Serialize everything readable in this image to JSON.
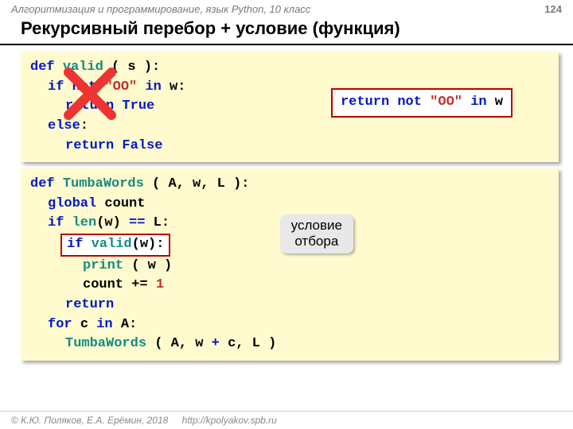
{
  "header": {
    "course": "Алгоритмизация и программирование, язык Python, 10 класс",
    "page": "124"
  },
  "title": "Рекурсивный перебор + условие (функция)",
  "code1": {
    "l1a": "def",
    "l1b": "valid",
    "l1c": "( s ):",
    "l2a": "if not",
    "l2b": "\"ОО\"",
    "l2c": "in",
    "l2d": "w:",
    "l3a": "return True",
    "l4a": "else",
    "l4b": ":",
    "l5a": "return False"
  },
  "callout1": {
    "a": "return not",
    "b": "\"ОО\"",
    "c": "in",
    "d": "w"
  },
  "code2": {
    "l1a": "def",
    "l1b": "TumbaWords",
    "l1c": "( A, w, L ):",
    "l2a": "global",
    "l2b": "count",
    "l3a": "if",
    "l3b": "len",
    "l3c": "(w)",
    "l3d": "==",
    "l3e": "L:",
    "l4a": "if",
    "l4b": "valid",
    "l4c": "(w):",
    "l5a": "print",
    "l5b": "( w )",
    "l6a": "count +=",
    "l6b": "1",
    "l7a": "return",
    "l8a": "for",
    "l8b": "c",
    "l8c": "in",
    "l8d": "A:",
    "l9a": "TumbaWords",
    "l9b": "( A, w",
    "l9c": "+",
    "l9d": "c, L )"
  },
  "note": {
    "line1": "условие",
    "line2": "отбора"
  },
  "footer": {
    "copy": "© К.Ю. Поляков, Е.А. Ерёмин, 2018",
    "url": "http://kpolyakov.spb.ru"
  }
}
